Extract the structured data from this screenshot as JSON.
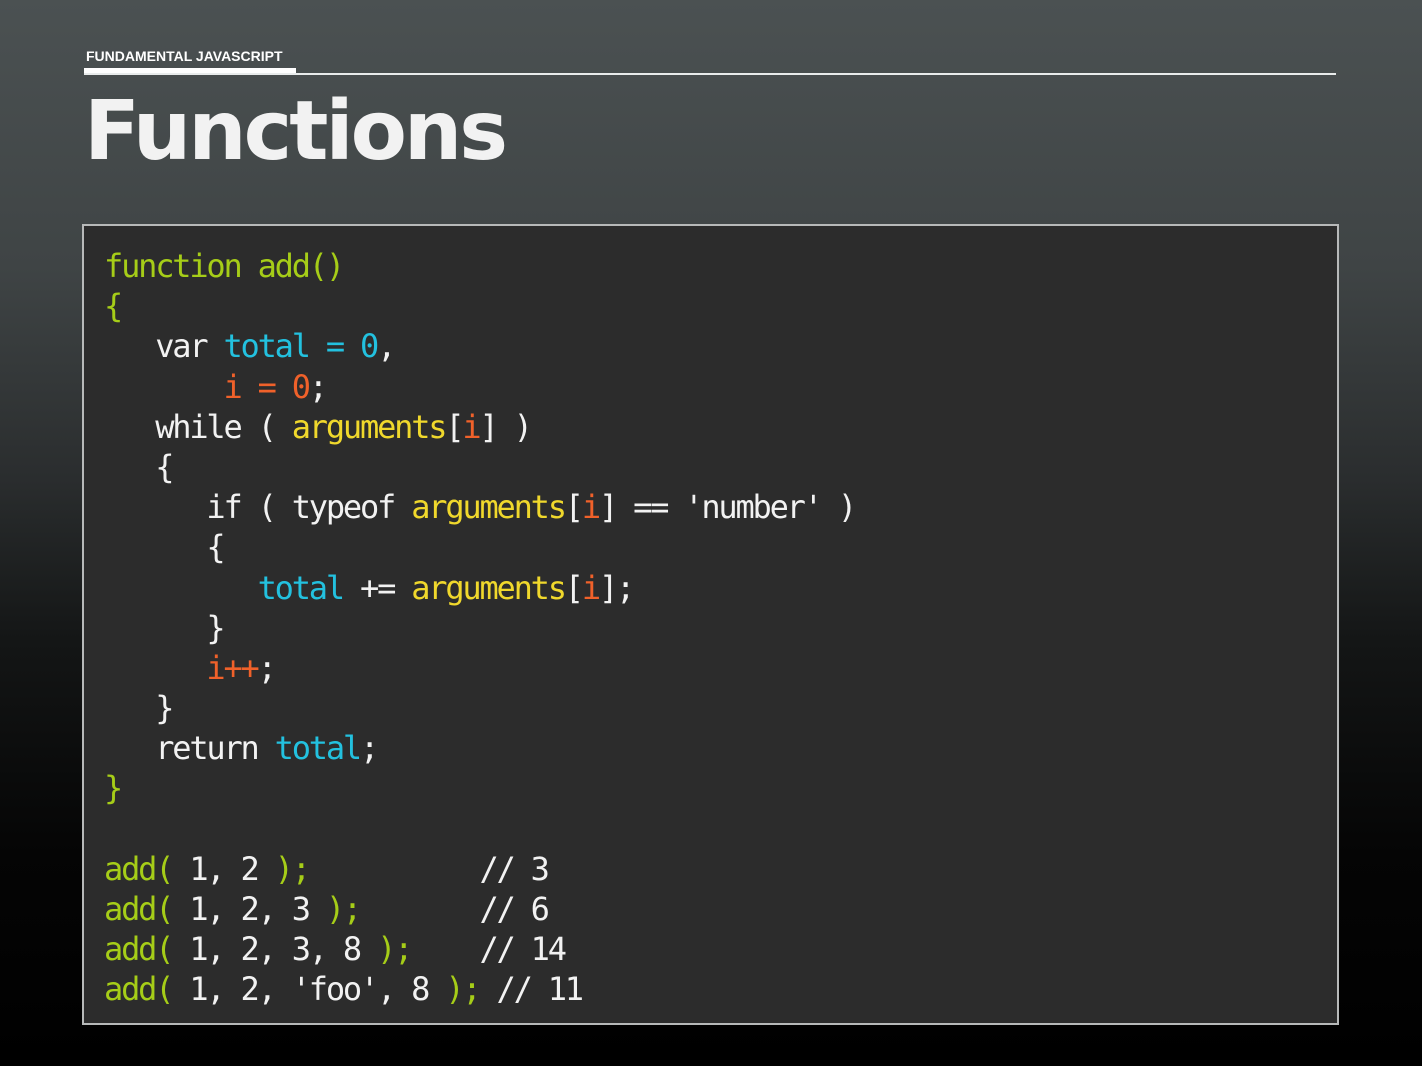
{
  "slide": {
    "section_label": "FUNDAMENTAL JAVASCRIPT",
    "title": "Functions"
  },
  "colors": {
    "keyword_green": "#a6cd18",
    "variable_cyan": "#23c1df",
    "counter_orange": "#f0612a",
    "arguments_yellow": "#f0d82c",
    "plain_white": "#f2f2f2",
    "code_background": "#2c2c2c"
  },
  "code": {
    "lines": [
      {
        "tokens": [
          {
            "text": "function add()",
            "style": "green"
          }
        ]
      },
      {
        "tokens": [
          {
            "text": "{",
            "style": "green"
          }
        ]
      },
      {
        "tokens": [
          {
            "text": "   var ",
            "style": "white"
          },
          {
            "text": "total = 0",
            "style": "cyan"
          },
          {
            "text": ",",
            "style": "white"
          }
        ]
      },
      {
        "tokens": [
          {
            "text": "       i = 0",
            "style": "orange"
          },
          {
            "text": ";",
            "style": "white"
          }
        ]
      },
      {
        "tokens": [
          {
            "text": "   while ( ",
            "style": "white"
          },
          {
            "text": "arguments",
            "style": "yellow"
          },
          {
            "text": "[",
            "style": "white"
          },
          {
            "text": "i",
            "style": "orange"
          },
          {
            "text": "] )",
            "style": "white"
          }
        ]
      },
      {
        "tokens": [
          {
            "text": "   {",
            "style": "white"
          }
        ]
      },
      {
        "tokens": [
          {
            "text": "      if ( typeof ",
            "style": "white"
          },
          {
            "text": "arguments",
            "style": "yellow"
          },
          {
            "text": "[",
            "style": "white"
          },
          {
            "text": "i",
            "style": "orange"
          },
          {
            "text": "] == 'number' )",
            "style": "white"
          }
        ]
      },
      {
        "tokens": [
          {
            "text": "      {",
            "style": "white"
          }
        ]
      },
      {
        "tokens": [
          {
            "text": "         ",
            "style": "white"
          },
          {
            "text": "total",
            "style": "cyan"
          },
          {
            "text": " += ",
            "style": "white"
          },
          {
            "text": "arguments",
            "style": "yellow"
          },
          {
            "text": "[",
            "style": "white"
          },
          {
            "text": "i",
            "style": "orange"
          },
          {
            "text": "];",
            "style": "white"
          }
        ]
      },
      {
        "tokens": [
          {
            "text": "      }",
            "style": "white"
          }
        ]
      },
      {
        "tokens": [
          {
            "text": "      i++",
            "style": "orange"
          },
          {
            "text": ";",
            "style": "white"
          }
        ]
      },
      {
        "tokens": [
          {
            "text": "   }",
            "style": "white"
          }
        ]
      },
      {
        "tokens": [
          {
            "text": "   return ",
            "style": "white"
          },
          {
            "text": "total",
            "style": "cyan"
          },
          {
            "text": ";",
            "style": "white"
          }
        ]
      },
      {
        "tokens": [
          {
            "text": "}",
            "style": "green"
          }
        ]
      },
      {
        "tokens": []
      },
      {
        "tokens": [
          {
            "text": "add(",
            "style": "green"
          },
          {
            "text": " 1, 2 ",
            "style": "white"
          },
          {
            "text": ");",
            "style": "green"
          },
          {
            "text": "          // 3",
            "style": "white"
          }
        ]
      },
      {
        "tokens": [
          {
            "text": "add(",
            "style": "green"
          },
          {
            "text": " 1, 2, 3 ",
            "style": "white"
          },
          {
            "text": ");",
            "style": "green"
          },
          {
            "text": "       // 6",
            "style": "white"
          }
        ]
      },
      {
        "tokens": [
          {
            "text": "add(",
            "style": "green"
          },
          {
            "text": " 1, 2, 3, 8 ",
            "style": "white"
          },
          {
            "text": ");",
            "style": "green"
          },
          {
            "text": "    // 14",
            "style": "white"
          }
        ]
      },
      {
        "tokens": [
          {
            "text": "add(",
            "style": "green"
          },
          {
            "text": " 1, 2, 'foo', 8 ",
            "style": "white"
          },
          {
            "text": ");",
            "style": "green"
          },
          {
            "text": " // 11",
            "style": "white"
          }
        ]
      }
    ]
  }
}
